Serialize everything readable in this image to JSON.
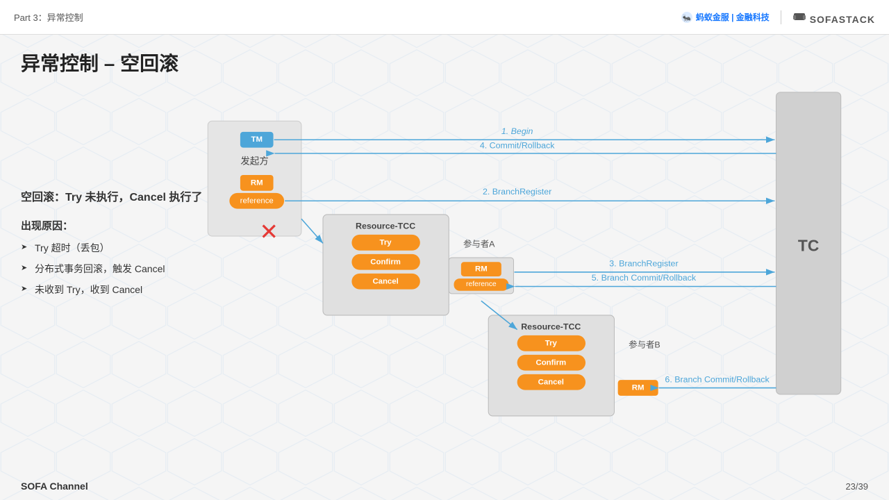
{
  "topbar": {
    "title": "Part 3：异常控制",
    "logo_ant": "蚂蚁金服 | 金融科技",
    "logo_sofa": "SOFASTACK"
  },
  "page": {
    "title": "异常控制 – 空回滚",
    "empty_rollback_desc": "空回滚：Try 未执行，Cancel 执行了",
    "cause_title": "出现原因：",
    "causes": [
      "Try 超时（丢包）",
      "分布式事务回滚，触发 Cancel",
      "未收到 Try，收到 Cancel"
    ],
    "footer": "SOFA Channel",
    "page_num": "23/39"
  },
  "diagram": {
    "initiator_label": "发起方",
    "participant_a_label": "参与者A",
    "participant_b_label": "参与者B",
    "tc_label": "TC",
    "tm_label": "TM",
    "rm_label": "RM",
    "rm_reference": "reference",
    "resource_tcc": "Resource-TCC",
    "arrows": [
      {
        "id": "arrow1",
        "label": "1. Begin"
      },
      {
        "id": "arrow2",
        "label": "4. Commit/Rollback"
      },
      {
        "id": "arrow3",
        "label": "2. BranchRegister"
      },
      {
        "id": "arrow4",
        "label": "3. BranchRegister"
      },
      {
        "id": "arrow5",
        "label": "5. Branch Commit/Rollback"
      },
      {
        "id": "arrow6",
        "label": "6. Branch Commit/Rollback"
      }
    ],
    "buttons": {
      "try": "Try",
      "confirm": "Confirm",
      "cancel": "Cancel"
    }
  }
}
